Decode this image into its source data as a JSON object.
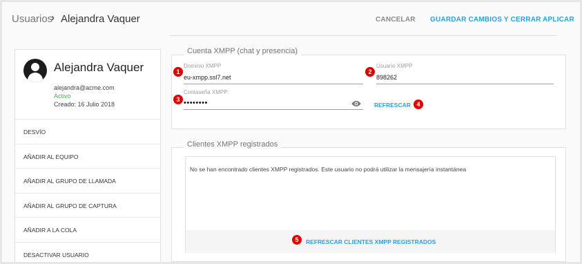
{
  "header": {
    "breadcrumb_root": "Usuarios",
    "breadcrumb_separator": "›",
    "breadcrumb_current": "Alejandra Vaquer",
    "cancel_label": "CANCELAR",
    "save_close_label": "GUARDAR CAMBIOS Y CERRAR",
    "apply_label": "APLICAR"
  },
  "profile": {
    "name": "Alejandra Vaquer",
    "email": "alejandra@acme.com",
    "status": "Activo",
    "created": "Creado: 16 Julio 2018",
    "avatar_icon": "user-avatar-icon"
  },
  "sidebar": {
    "items": [
      {
        "label": "DESVÍO"
      },
      {
        "label": "AÑADIR AL EQUIPO"
      },
      {
        "label": "AÑADIR AL GRUPO DE LLAMADA"
      },
      {
        "label": "AÑADIR AL GRUPO DE CAPTURA"
      },
      {
        "label": "AÑADIR A LA COLA"
      },
      {
        "label": "DESACTIVAR USUARIO"
      }
    ]
  },
  "xmpp_account": {
    "title": "Cuenta XMPP (chat y presencia)",
    "domain_label": "Dominio XMPP",
    "domain_value": "eu-xmpp.ssl7.net",
    "user_label": "Usuario XMPP",
    "user_value": "898262",
    "password_label": "Contaseña XMPP:",
    "password_value": "••••••••",
    "eye_icon": "eye-icon",
    "refresh_label": "REFRESCAR"
  },
  "xmpp_clients": {
    "title": "Clientes XMPP registrados",
    "empty_message": "No se han encontrado clientes XMPP registrados. Este usuario no podrá utilizar la mensajería instantánea",
    "refresh_label": "REFRESCAR CLIENTES XMPP REGISTRADOS"
  },
  "annotations": {
    "badge_1": "1",
    "badge_2": "2",
    "badge_3": "3",
    "badge_4": "4",
    "badge_5": "5",
    "badge_color": "#e00000"
  },
  "colors": {
    "accent": "#29a3e0",
    "active_status": "#4caf50"
  }
}
